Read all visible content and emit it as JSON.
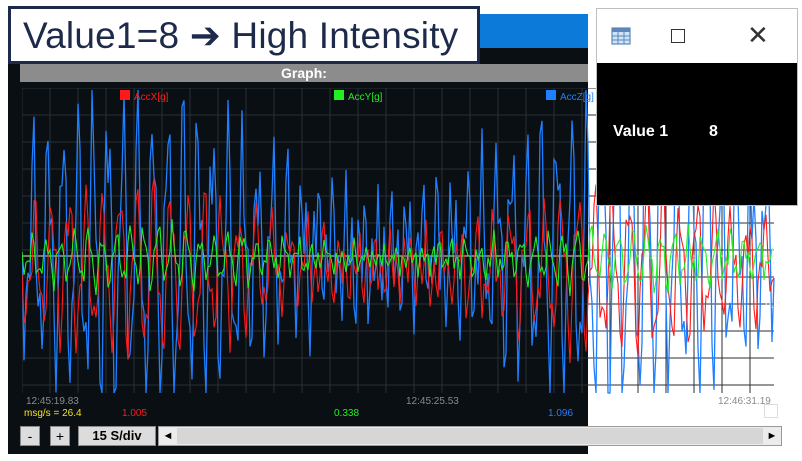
{
  "callout": {
    "text": "Value1=8 ➔ High Intensity"
  },
  "graph": {
    "header": "Graph:",
    "legend": [
      {
        "label": "AccX[g]",
        "color": "#ff1a1a"
      },
      {
        "label": "AccY[g]",
        "color": "#22ee22"
      },
      {
        "label": "AccZ[g]",
        "color": "#1e7fff"
      }
    ],
    "y_ticks": [
      "0",
      "-0.5",
      "-1"
    ],
    "time_labels": [
      "12:45:19.83",
      "12:45:25.53",
      "12:46:31.19"
    ],
    "status": {
      "rate": "msg/s = 26.4",
      "accx_value": "1.005",
      "accy_value": "0.338",
      "accz_value": "1.096"
    },
    "colors": {
      "accx": "#ff1a1a",
      "accy": "#22ee22",
      "accz": "#1e7fff",
      "grid": "#2a2f35",
      "zero": "#e6e6cc"
    }
  },
  "popup": {
    "label": "Value 1",
    "value": "8",
    "icons": [
      "table-icon",
      "maximize-icon",
      "close-icon"
    ]
  },
  "controls": {
    "minus": "-",
    "plus": "+",
    "speed": "15 S/div",
    "left": "◄",
    "right": "►"
  }
}
